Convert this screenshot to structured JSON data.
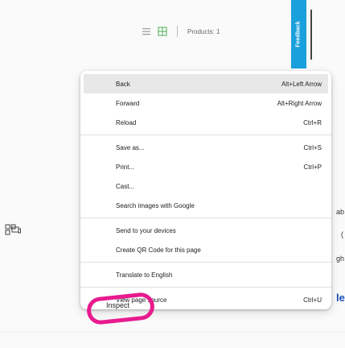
{
  "toolbar": {
    "list_icon": "list-icon",
    "grid_icon": "grid-icon",
    "products_label": "Products: 1"
  },
  "feedback_label": "Feedback",
  "side_fragments": [
    "ab",
    "(",
    "gh",
    "le"
  ],
  "context_menu": {
    "items": [
      {
        "label": "Back",
        "shortcut": "Alt+Left Arrow"
      },
      {
        "label": "Forward",
        "shortcut": "Alt+Right Arrow"
      },
      {
        "label": "Reload",
        "shortcut": "Ctrl+R"
      },
      {
        "label": "Save as...",
        "shortcut": "Ctrl+S"
      },
      {
        "label": "Print...",
        "shortcut": "Ctrl+P"
      },
      {
        "label": "Cast...",
        "shortcut": ""
      },
      {
        "label": "Search images with Google",
        "shortcut": ""
      },
      {
        "label": "Send to your devices",
        "shortcut": ""
      },
      {
        "label": "Create QR Code for this page",
        "shortcut": ""
      },
      {
        "label": "Translate to English",
        "shortcut": ""
      },
      {
        "label": "View page source",
        "shortcut": "Ctrl+U"
      },
      {
        "label": "Inspect",
        "shortcut": ""
      }
    ]
  },
  "colors": {
    "feedback": "#1aa0dc",
    "annotation": "#e81b8e",
    "highlight": "#e8e8e8"
  }
}
